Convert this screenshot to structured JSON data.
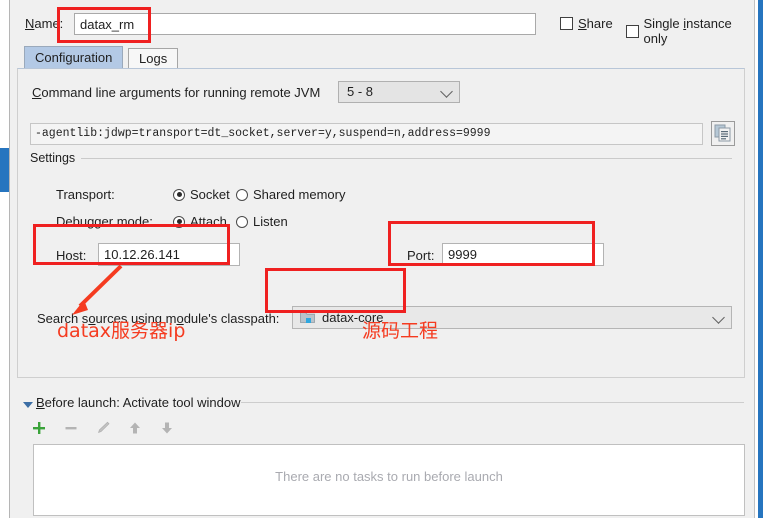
{
  "window": {
    "name_label": "Name:",
    "name_value": "datax_rm",
    "share_label": "Share",
    "single_instance_label": "Single instance only",
    "share_checked": false,
    "single_instance_checked": false
  },
  "tabs": [
    {
      "label": "Configuration",
      "active": true
    },
    {
      "label": "Logs",
      "active": false
    }
  ],
  "configuration": {
    "cmdline_label": "Command line arguments for running remote JVM",
    "jvm_version": "5 - 8",
    "cmdline_value": "-agentlib:jdwp=transport=dt_socket,server=y,suspend=n,address=9999",
    "copy_icon": "copy-to-clipboard-icon",
    "settings_title": "Settings",
    "transport_label": "Transport:",
    "transport_options": [
      "Socket",
      "Shared memory"
    ],
    "transport_selected": "Socket",
    "debugger_mode_label": "Debugger mode:",
    "debugger_mode_options": [
      "Attach",
      "Listen"
    ],
    "debugger_mode_selected": "Attach",
    "host_label": "Host:",
    "host_value": "10.12.26.141",
    "port_label": "Port:",
    "port_value": "9999",
    "module_label": "Search sources using module's classpath:",
    "module_value": "datax-core",
    "module_icon": "module-folder-icon"
  },
  "before_launch": {
    "title": "Before launch: Activate tool window",
    "toolbar": [
      {
        "name": "add-task-button",
        "glyph": "+"
      },
      {
        "name": "remove-task-button",
        "glyph": "−"
      },
      {
        "name": "edit-task-button",
        "glyph": "pencil"
      },
      {
        "name": "move-up-button",
        "glyph": "↑"
      },
      {
        "name": "move-down-button",
        "glyph": "↓"
      }
    ],
    "empty_message": "There are no tasks to run before launch"
  },
  "annotations": {
    "accent_color": "#ef2020",
    "text_color": "#f53b20",
    "host_note": "datax服务器ip",
    "module_note": "源码工程"
  }
}
